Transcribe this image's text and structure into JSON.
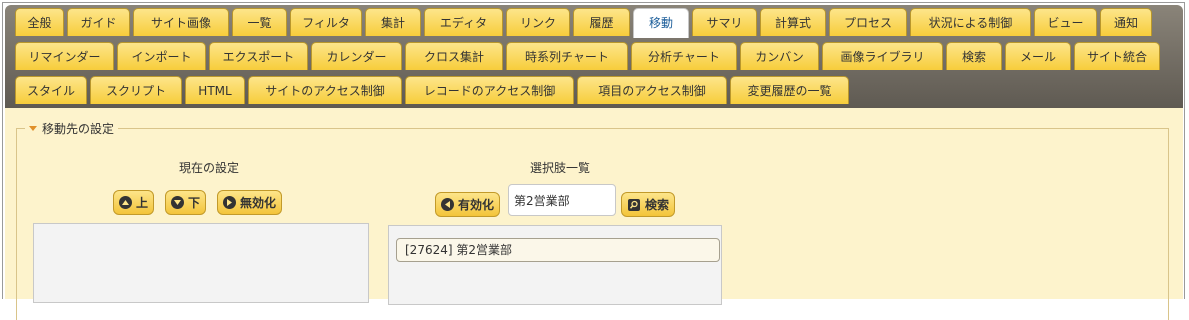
{
  "tabs_row1": [
    {
      "label": "全般"
    },
    {
      "label": "ガイド"
    },
    {
      "label": "サイト画像"
    },
    {
      "label": "一覧"
    },
    {
      "label": "フィルタ"
    },
    {
      "label": "集計"
    },
    {
      "label": "エディタ"
    },
    {
      "label": "リンク"
    },
    {
      "label": "履歴"
    },
    {
      "label": "移動",
      "active": true
    },
    {
      "label": "サマリ"
    },
    {
      "label": "計算式"
    },
    {
      "label": "プロセス"
    },
    {
      "label": "状況による制御"
    },
    {
      "label": "ビュー"
    },
    {
      "label": "通知"
    }
  ],
  "tabs_row2": [
    {
      "label": "リマインダー"
    },
    {
      "label": "インポート"
    },
    {
      "label": "エクスポート"
    },
    {
      "label": "カレンダー"
    },
    {
      "label": "クロス集計"
    },
    {
      "label": "時系列チャート"
    },
    {
      "label": "分析チャート"
    },
    {
      "label": "カンバン"
    },
    {
      "label": "画像ライブラリ"
    },
    {
      "label": "検索"
    },
    {
      "label": "メール"
    },
    {
      "label": "サイト統合"
    }
  ],
  "tabs_row3": [
    {
      "label": "スタイル"
    },
    {
      "label": "スクリプト"
    },
    {
      "label": "HTML"
    },
    {
      "label": "サイトのアクセス制御"
    },
    {
      "label": "レコードのアクセス制御"
    },
    {
      "label": "項目のアクセス制御"
    },
    {
      "label": "変更履歴の一覧"
    }
  ],
  "section": {
    "title": "移動先の設定"
  },
  "current": {
    "title": "現在の設定",
    "up_label": "上",
    "down_label": "下",
    "disable_label": "無効化"
  },
  "choices": {
    "title": "選択肢一覧",
    "enable_label": "有効化",
    "search_value": "第2営業部",
    "search_button": "検索",
    "items": [
      {
        "label": "[27624] 第2営業部"
      }
    ]
  },
  "colors": {
    "tab": "#f7cd3b",
    "active_tab_text": "#1a5c99",
    "panel": "#fdf3cc",
    "tabbar": "#6f6a61"
  }
}
